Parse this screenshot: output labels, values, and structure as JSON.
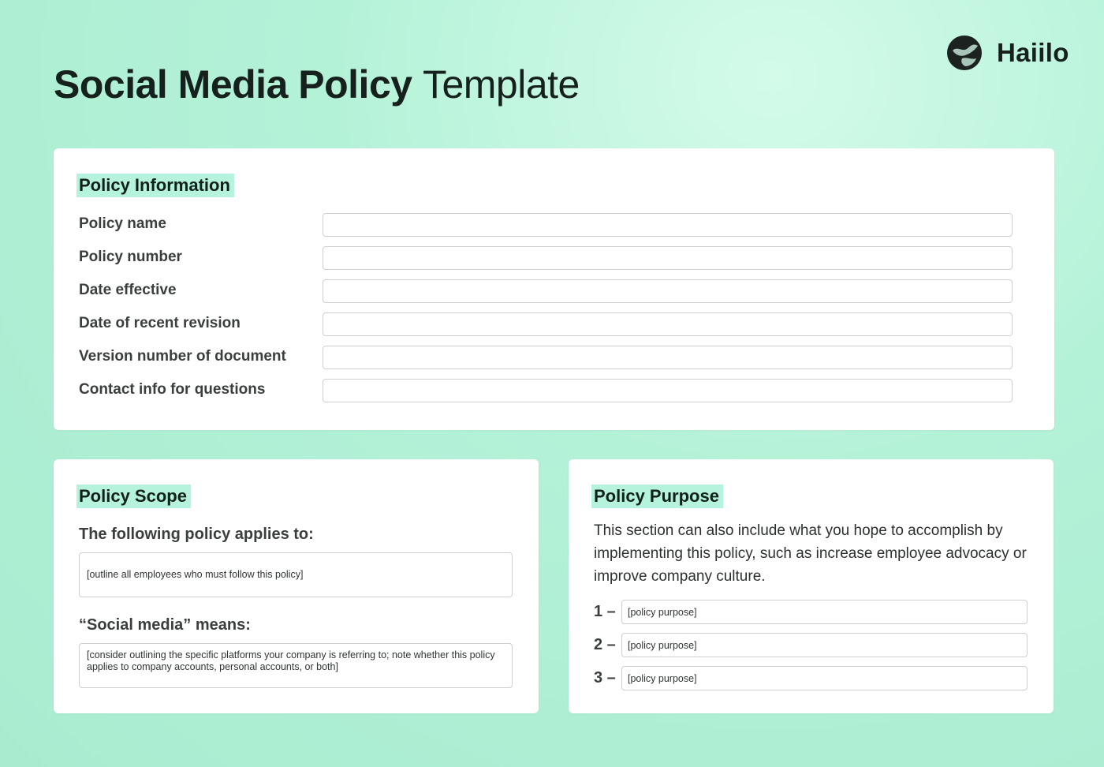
{
  "header": {
    "title_bold": "Social Media Policy",
    "title_light": "Template",
    "brand": "Haiilo",
    "brand_icon": "haiilo-logo-icon"
  },
  "colors": {
    "background": "#adefd3",
    "highlight": "#b6f3dc",
    "text_dark": "#16201d"
  },
  "policy_information": {
    "heading": "Policy Information",
    "fields": [
      {
        "label": "Policy name",
        "value": ""
      },
      {
        "label": "Policy number",
        "value": ""
      },
      {
        "label": "Date effective",
        "value": ""
      },
      {
        "label": "Date of recent revision",
        "value": ""
      },
      {
        "label": "Version number of document",
        "value": ""
      },
      {
        "label": "Contact info for questions",
        "value": ""
      }
    ]
  },
  "policy_scope": {
    "heading": "Policy Scope",
    "applies_label": "The following policy applies to:",
    "applies_placeholder": "[outline all employees who must follow this policy]",
    "means_label": "“Social media” means:",
    "means_placeholder": "[consider outlining the specific platforms your company is referring to; note whether this policy applies to company accounts, personal accounts, or both]"
  },
  "policy_purpose": {
    "heading": "Policy Purpose",
    "description": "This section can also include what you hope to accomplish by implementing this policy, such as increase employee advocacy or improve company culture.",
    "items": [
      {
        "number": "1 –",
        "placeholder": "[policy purpose]"
      },
      {
        "number": "2 –",
        "placeholder": "[policy purpose]"
      },
      {
        "number": "3 –",
        "placeholder": "[policy purpose]"
      }
    ]
  }
}
